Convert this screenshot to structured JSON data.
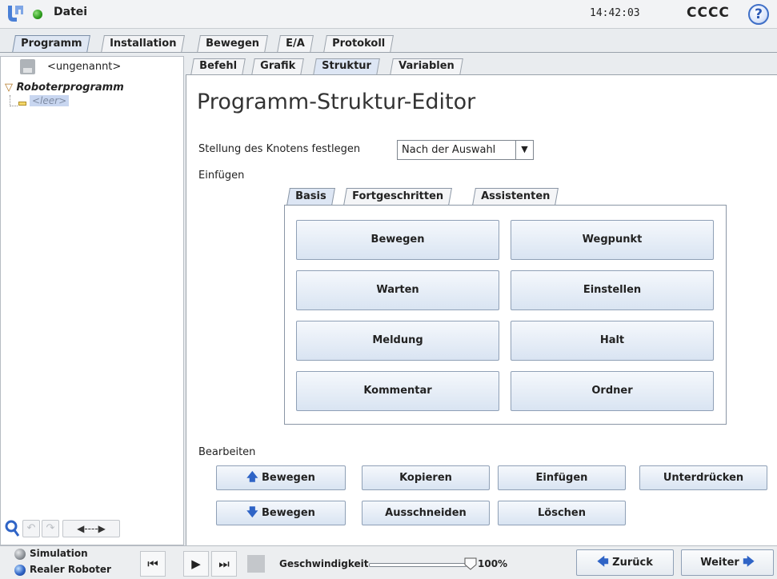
{
  "titlebar": {
    "file_menu": "Datei",
    "clock": "14:42:03",
    "robot_name": "CCCC",
    "help": "?"
  },
  "main_tabs": [
    {
      "label": "Programm"
    },
    {
      "label": "Installation"
    },
    {
      "label": "Bewegen"
    },
    {
      "label": "E/A"
    },
    {
      "label": "Protokoll"
    }
  ],
  "left_panel": {
    "program_name": "<ungenannt>",
    "tree_root": "Roboterprogramm",
    "tree_child": "<leer>"
  },
  "sub_tabs": [
    {
      "label": "Befehl"
    },
    {
      "label": "Grafik"
    },
    {
      "label": "Struktur"
    },
    {
      "label": "Variablen"
    }
  ],
  "editor": {
    "title": "Programm-Struktur-Editor",
    "position_label": "Stellung des Knotens festlegen",
    "position_value": "Nach der Auswahl",
    "insert_label": "Einfügen",
    "insert_tabs": [
      {
        "label": "Basis"
      },
      {
        "label": "Fortgeschritten"
      },
      {
        "label": "Assistenten"
      }
    ],
    "insert_buttons": {
      "move": "Bewegen",
      "waypoint": "Wegpunkt",
      "wait": "Warten",
      "set": "Einstellen",
      "message": "Meldung",
      "halt": "Halt",
      "comment": "Kommentar",
      "folder": "Ordner"
    },
    "edit_label": "Bearbeiten",
    "edit_buttons": {
      "move_up": "Bewegen",
      "copy": "Kopieren",
      "paste": "Einfügen",
      "suppress": "Unterdrücken",
      "move_down": "Bewegen",
      "cut": "Ausschneiden",
      "delete": "Löschen"
    }
  },
  "bottombar": {
    "simulation": "Simulation",
    "real_robot": "Realer Roboter",
    "speed_label": "Geschwindigkeit",
    "speed_value": "100%",
    "speed_fraction": 1.0,
    "back": "Zurück",
    "next": "Weiter"
  },
  "colors": {
    "accent_blue": "#2f64c6",
    "running_green": "#2b9a1b"
  }
}
